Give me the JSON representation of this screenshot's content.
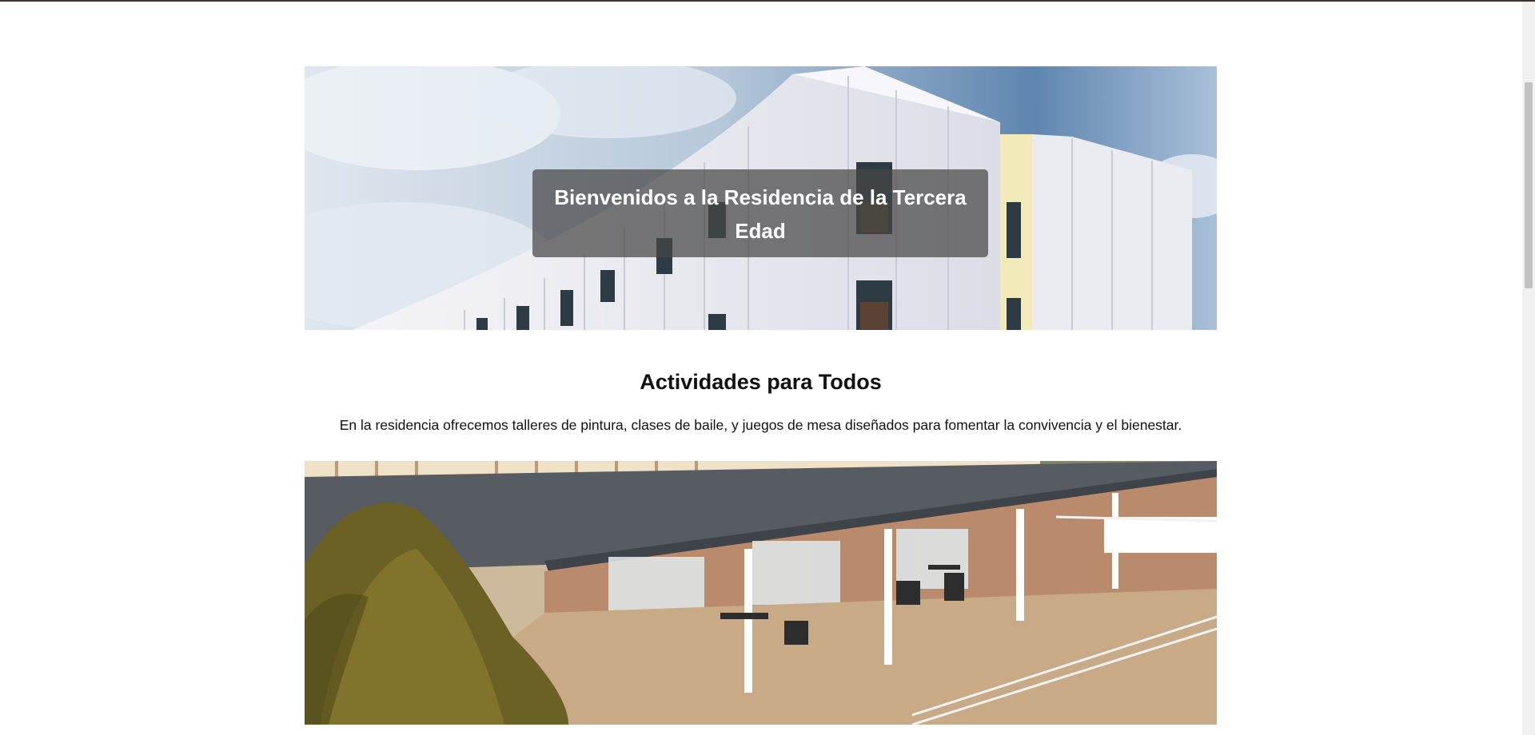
{
  "hero": {
    "title": "Bienvenidos a la Residencia de la Tercera Edad",
    "image": "modern white residence building under cloudy blue sky"
  },
  "activities": {
    "heading": "Actividades para Todos",
    "description": "En la residencia ofrecemos talleres de pintura, clases de baile, y juegos de mesa diseñados para fomentar la convivencia y el bienestar."
  },
  "gallery": {
    "image": "covered terrace with tables and chairs, tree in foreground"
  },
  "colors": {
    "caption_bg": "#464646",
    "text": "#111111",
    "background": "#ffffff"
  }
}
